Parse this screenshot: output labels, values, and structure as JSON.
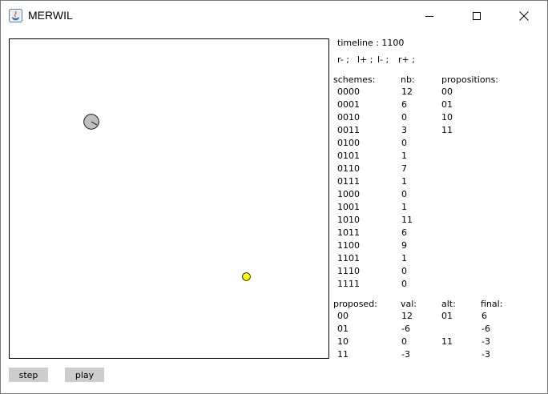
{
  "window": {
    "title": "MERWIL"
  },
  "timeline_text": "timeline : 1100",
  "actions": [
    "r- ;",
    "l+ ;",
    "l- ;",
    "r+ ;"
  ],
  "schemes_table": {
    "headers": {
      "scheme": "schemes:",
      "nb": "nb:",
      "propositions": "propositions:"
    },
    "rows": [
      {
        "scheme": "0000",
        "nb": "12"
      },
      {
        "scheme": "0001",
        "nb": "6"
      },
      {
        "scheme": "0010",
        "nb": "0"
      },
      {
        "scheme": "0011",
        "nb": "3"
      },
      {
        "scheme": "0100",
        "nb": "0"
      },
      {
        "scheme": "0101",
        "nb": "1"
      },
      {
        "scheme": "0110",
        "nb": "7"
      },
      {
        "scheme": "0111",
        "nb": "1"
      },
      {
        "scheme": "1000",
        "nb": "0"
      },
      {
        "scheme": "1001",
        "nb": "1"
      },
      {
        "scheme": "1010",
        "nb": "11"
      },
      {
        "scheme": "1011",
        "nb": "6"
      },
      {
        "scheme": "1100",
        "nb": "9"
      },
      {
        "scheme": "1101",
        "nb": "1"
      },
      {
        "scheme": "1110",
        "nb": "0"
      },
      {
        "scheme": "1111",
        "nb": "0"
      }
    ],
    "propositions": [
      "00",
      "01",
      "10",
      "11"
    ]
  },
  "proposed_table": {
    "headers": {
      "proposed": "proposed:",
      "val": "val:",
      "alt": "alt:",
      "final": "final:"
    },
    "rows": [
      {
        "proposed": "00",
        "val": "12",
        "alt": "01",
        "final": "6"
      },
      {
        "proposed": "01",
        "val": "-6",
        "alt": "",
        "final": "-6"
      },
      {
        "proposed": "10",
        "val": "0",
        "alt": "11",
        "final": "-3"
      },
      {
        "proposed": "11",
        "val": "-3",
        "alt": "",
        "final": "-3"
      }
    ]
  },
  "buttons": {
    "step": "step",
    "play": "play"
  },
  "colors": {
    "agent": "#c0c0c0",
    "target": "#ffff00",
    "button": "#cdcdcd"
  }
}
